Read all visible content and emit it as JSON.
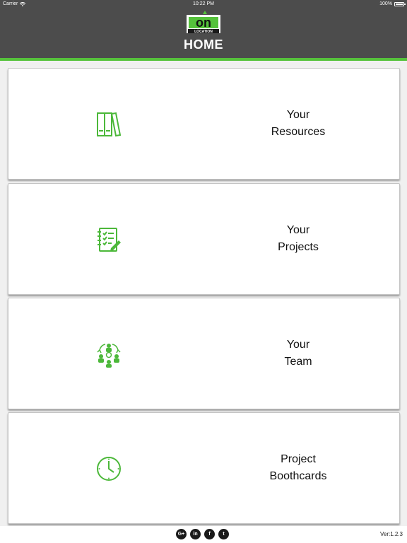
{
  "status_bar": {
    "carrier": "Carrier",
    "time": "10:22 PM",
    "battery": "100%"
  },
  "header": {
    "logo_text": "on",
    "logo_subtext": "LOCATION",
    "title": "HOME"
  },
  "cards": [
    {
      "line1": "Your",
      "line2": "Resources",
      "icon": "books-icon"
    },
    {
      "line1": "Your",
      "line2": "Projects",
      "icon": "checklist-icon"
    },
    {
      "line1": "Your",
      "line2": "Team",
      "icon": "team-icon"
    },
    {
      "line1": "Project",
      "line2": "Boothcards",
      "icon": "clock-icon"
    }
  ],
  "footer": {
    "social": [
      {
        "label": "G+",
        "icon": "google-plus-icon"
      },
      {
        "label": "in",
        "icon": "linkedin-icon"
      },
      {
        "label": "f",
        "icon": "facebook-icon"
      },
      {
        "label": "t",
        "icon": "twitter-icon"
      }
    ],
    "version": "Ver:1.2.3"
  },
  "colors": {
    "header_bg": "#4c4c4c",
    "accent": "#55c23b",
    "icon_green": "#4cb83a"
  }
}
